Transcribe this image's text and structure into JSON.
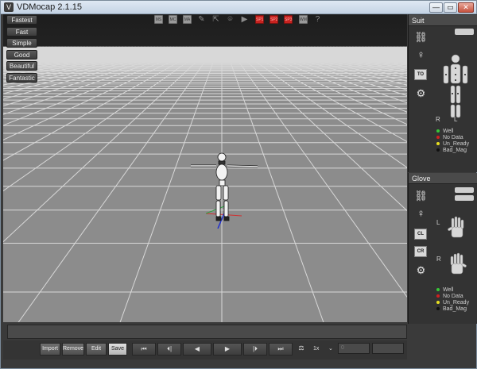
{
  "window": {
    "title": "VDMocap 2.1.15",
    "minimize": "—",
    "maximize": "▭",
    "close": "✕"
  },
  "quality_buttons": [
    "Fastest",
    "Fast",
    "Simple",
    "Good",
    "Beautiful",
    "Fantastic"
  ],
  "toolbar": {
    "ms": "MS",
    "mc": "MC",
    "ma": "MA",
    "wm": "WM",
    "red1": "SP1",
    "red2": "SP2",
    "red3": "SP3"
  },
  "suit_panel": {
    "header": "Suit",
    "to_label": "TO",
    "label_r": "R",
    "label_l": "L",
    "legend": [
      {
        "label": "Well",
        "color": "#38c838"
      },
      {
        "label": "No Data",
        "color": "#d02020"
      },
      {
        "label": "Un_Ready",
        "color": "#e8e020"
      },
      {
        "label": "Bad_Mag",
        "color": "#111111"
      }
    ]
  },
  "glove_panel": {
    "header": "Glove",
    "cl_label": "CL",
    "cr_label": "CR",
    "label_l": "L",
    "label_r": "R",
    "legend": [
      {
        "label": "Well",
        "color": "#38c838"
      },
      {
        "label": "No Data",
        "color": "#d02020"
      },
      {
        "label": "Un_Ready",
        "color": "#e8e020"
      },
      {
        "label": "Bad_Mag",
        "color": "#111111"
      }
    ]
  },
  "transport": {
    "import": "Import",
    "remove": "Remove",
    "edit": "Edit",
    "save": "Save",
    "first": "⏮",
    "step_back": "⏴|",
    "rewind": "◀",
    "play": "▶",
    "step_fwd": "|⏵",
    "last": "⏭",
    "speed": "1x",
    "speed_arrow": "⌄",
    "frame_value": "0"
  }
}
